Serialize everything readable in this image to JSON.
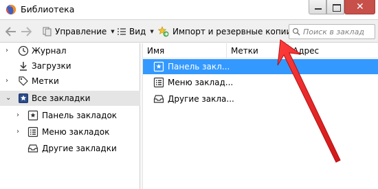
{
  "window": {
    "title": "Библиотека",
    "app_icon": "firefox-icon",
    "controls": [
      "minimize-icon",
      "maximize-icon",
      "close-icon"
    ],
    "close_glyph": "✕"
  },
  "toolbar": {
    "back_icon": "arrow-left-icon",
    "forward_icon": "arrow-right-icon",
    "organize_label": "Управление",
    "views_label": "Вид",
    "import_label": "Импорт и резервные копии",
    "search_placeholder": "Поиск в заклад"
  },
  "sidebar": {
    "items": [
      {
        "label": "Журнал",
        "icon": "clock-icon",
        "expandable": true,
        "expanded": false
      },
      {
        "label": "Загрузки",
        "icon": "download-icon",
        "expandable": false
      },
      {
        "label": "Метки",
        "icon": "tag-icon",
        "expandable": true,
        "expanded": false
      },
      {
        "label": "Все закладки",
        "icon": "bookmark-star-icon",
        "expandable": true,
        "expanded": true,
        "selected": true
      },
      {
        "label": "Панель закладок",
        "icon": "bookmark-toolbar-icon",
        "expandable": true,
        "expanded": false
      },
      {
        "label": "Меню закладок",
        "icon": "bookmark-menu-icon",
        "expandable": true,
        "expanded": false
      },
      {
        "label": "Другие закладки",
        "icon": "unsorted-bookmarks-icon",
        "expandable": false
      }
    ]
  },
  "columns": {
    "name": "Имя",
    "tags": "Метки",
    "address": "Адрес"
  },
  "rows": [
    {
      "label": "Панель закл...",
      "icon": "bookmark-toolbar-icon",
      "selected": true
    },
    {
      "label": "Меню заклад...",
      "icon": "bookmark-menu-icon",
      "selected": false
    },
    {
      "label": "Другие закла...",
      "icon": "unsorted-bookmarks-icon",
      "selected": false
    }
  ],
  "colors": {
    "selection": "#3399ff",
    "close_button": "#c7504a",
    "annotation_arrow": "#e02020"
  }
}
